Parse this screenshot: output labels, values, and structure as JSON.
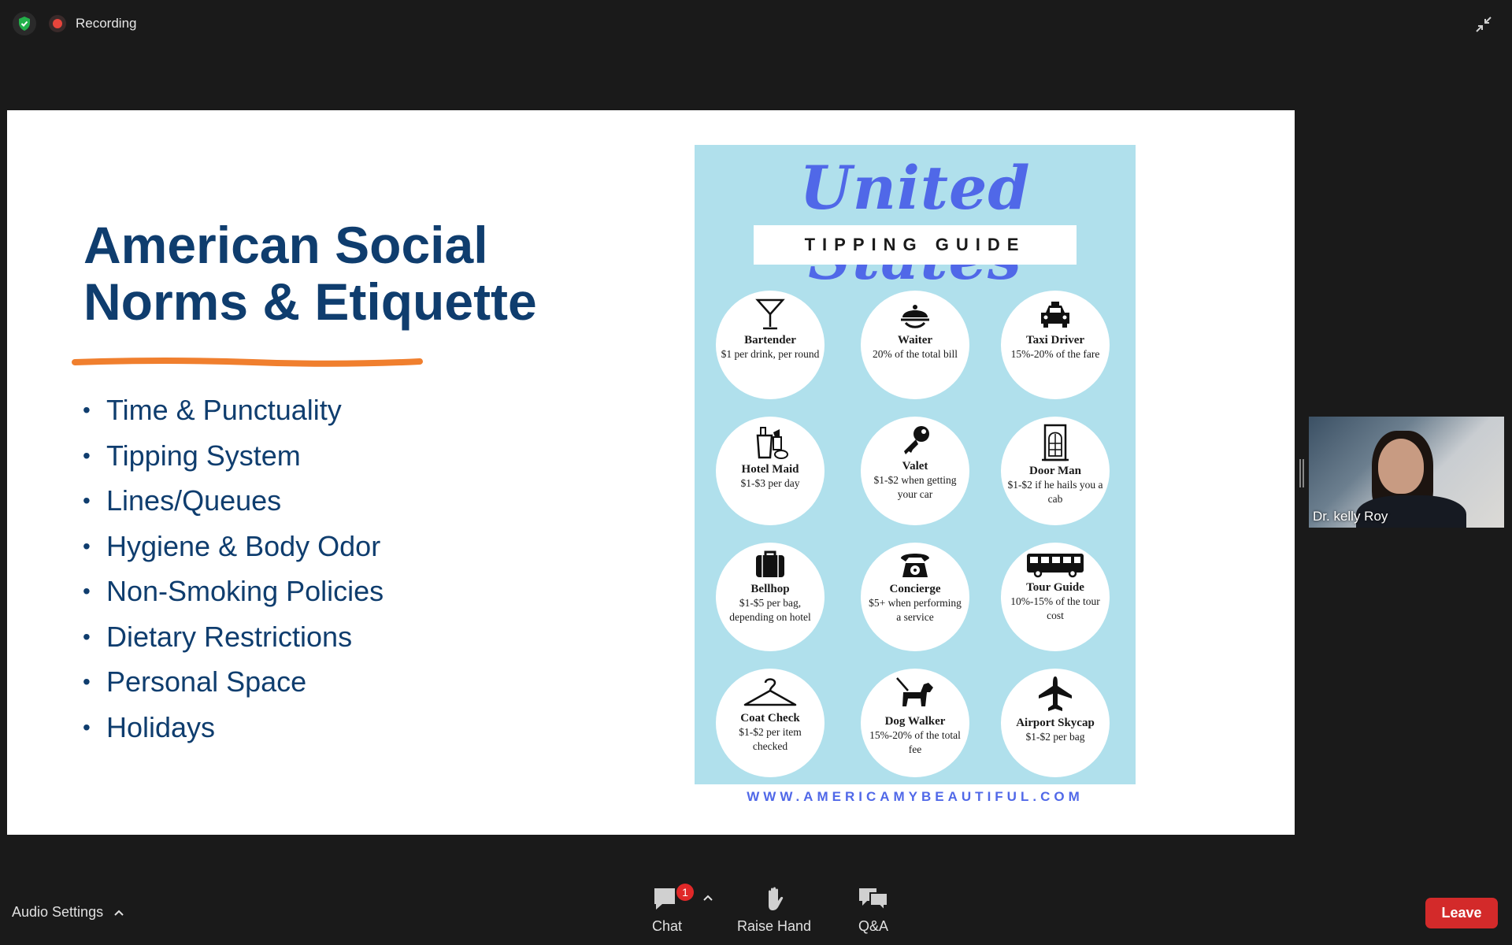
{
  "topbar": {
    "recording_label": "Recording"
  },
  "slide": {
    "title": "American Social\nNorms & Etiquette",
    "bullets": [
      "Time & Punctuality",
      "Tipping System",
      "Lines/Queues",
      "Hygiene & Body Odor",
      "Non-Smoking Policies",
      "Dietary Restrictions",
      "Personal Space",
      "Holidays"
    ],
    "accent_color": "#f07f2e",
    "title_color": "#0f3d6e"
  },
  "poster": {
    "title": "United States",
    "subtitle": "TIPPING GUIDE",
    "url": "WWW.AMERICAMYBEAUTIFUL.COM",
    "items": [
      {
        "name": "Bartender",
        "desc": "$1 per drink, per round",
        "icon": "cocktail-icon"
      },
      {
        "name": "Waiter",
        "desc": "20% of the total bill",
        "icon": "cloche-icon"
      },
      {
        "name": "Taxi Driver",
        "desc": "15%-20% of the fare",
        "icon": "taxi-icon"
      },
      {
        "name": "Hotel Maid",
        "desc": "$1-$3 per day",
        "icon": "cleaning-supplies-icon"
      },
      {
        "name": "Valet",
        "desc": "$1-$2 when getting your car",
        "icon": "key-icon"
      },
      {
        "name": "Door Man",
        "desc": "$1-$2 if he hails you a cab",
        "icon": "door-icon"
      },
      {
        "name": "Bellhop",
        "desc": "$1-$5 per bag, depending on hotel",
        "icon": "suitcase-icon"
      },
      {
        "name": "Concierge",
        "desc": "$5+ when performing a service",
        "icon": "telephone-icon"
      },
      {
        "name": "Tour Guide",
        "desc": "10%-15% of the tour cost",
        "icon": "bus-icon"
      },
      {
        "name": "Coat Check",
        "desc": "$1-$2 per item checked",
        "icon": "hanger-icon"
      },
      {
        "name": "Dog Walker",
        "desc": "15%-20% of the total fee",
        "icon": "dog-icon"
      },
      {
        "name": "Airport Skycap",
        "desc": "$1-$2 per bag",
        "icon": "airplane-icon"
      }
    ]
  },
  "participant": {
    "name": "Dr. kelly Roy"
  },
  "toolbar": {
    "audio_settings": "Audio Settings",
    "chat_label": "Chat",
    "chat_badge": "1",
    "raise_hand_label": "Raise Hand",
    "qa_label": "Q&A",
    "leave_label": "Leave",
    "leave_color": "#d32a2a"
  }
}
